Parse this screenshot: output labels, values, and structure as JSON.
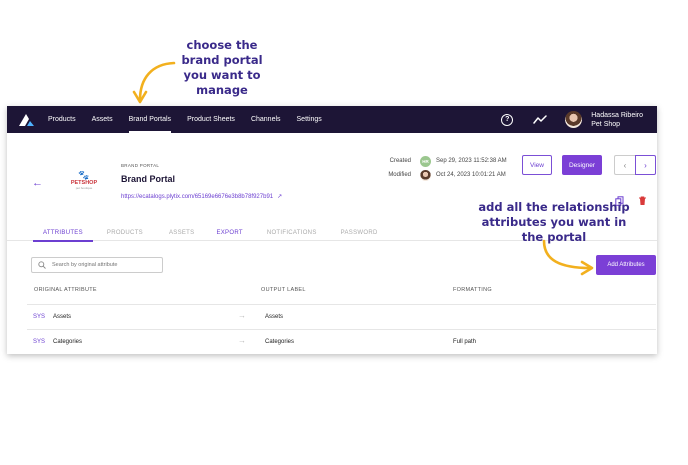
{
  "annotations": {
    "top": "choose the brand portal you want to manage",
    "right": "add all the relationship attributes you want in the portal"
  },
  "colors": {
    "nav_bg": "#1d1536",
    "accent": "#7b3fd6",
    "annotation": "#3a2a8a",
    "arrow": "#f2b01e",
    "logo_red": "#c9333a"
  },
  "nav": {
    "items": [
      "Products",
      "Assets",
      "Brand Portals",
      "Product Sheets",
      "Channels",
      "Settings"
    ],
    "active": "Brand Portals",
    "help_icon": "?",
    "user": {
      "name": "Hadassa Ribeiro",
      "account": "Pet Shop"
    }
  },
  "portal": {
    "caption": "BRAND PORTAL",
    "title": "Brand Portal",
    "url": "https://ecatalogs.plytix.com/65169e6676e3b8b78f927b91",
    "logo": {
      "brand": "PETSHOP",
      "paw": "🐾",
      "tagline": "pet boutique"
    }
  },
  "meta": {
    "created_label": "Created",
    "created_badge": "HR",
    "created_date": "Sep 29, 2023 11:52:38 AM",
    "modified_label": "Modified",
    "modified_date": "Oct 24, 2023 10:01:21 AM"
  },
  "buttons": {
    "view": "View",
    "designer": "Designer",
    "add_attributes": "Add Attributes",
    "prev": "‹",
    "next": "›"
  },
  "tabs": [
    "ATTRIBUTES",
    "PRODUCTS",
    "ASSETS",
    "EXPORT",
    "NOTIFICATIONS",
    "PASSWORD"
  ],
  "search": {
    "placeholder": "Search by original attribute"
  },
  "table": {
    "headers": [
      "ORIGINAL ATTRIBUTE",
      "OUTPUT LABEL",
      "FORMATTING"
    ],
    "rows": [
      {
        "tag": "SYS",
        "original": "Assets",
        "arrow": "→",
        "output": "Assets",
        "formatting": ""
      },
      {
        "tag": "SYS",
        "original": "Categories",
        "arrow": "→",
        "output": "Categories",
        "formatting": "Full path"
      }
    ]
  }
}
